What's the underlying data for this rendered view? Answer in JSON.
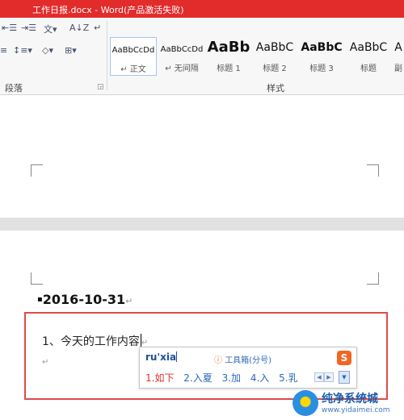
{
  "window": {
    "title": "工作日报.docx - Word(产品激活失败)"
  },
  "ribbon": {
    "paragraph_group": {
      "label": "段落",
      "tools": [
        {
          "icon": "decrease-indent-icon",
          "glyph": "⇤☰"
        },
        {
          "icon": "increase-indent-icon",
          "glyph": "⇥☰"
        },
        {
          "icon": "chinese-layout-icon",
          "glyph": "文▾"
        },
        {
          "icon": "sort-icon",
          "glyph": "A↓Z"
        },
        {
          "icon": "show-marks-icon",
          "glyph": "↵"
        },
        {
          "icon": "align-icon",
          "glyph": "≡"
        },
        {
          "icon": "line-spacing-icon",
          "glyph": "↕≡▾"
        },
        {
          "icon": "shading-icon",
          "glyph": "◇▾"
        },
        {
          "icon": "borders-icon",
          "glyph": "⊞▾"
        }
      ]
    },
    "styles_group": {
      "label": "样式",
      "items": [
        {
          "sample": "AaBbCcDd",
          "name": "↵ 正文",
          "selected": true
        },
        {
          "sample": "AaBbCcDd",
          "name": "↵ 无间隔",
          "selected": false
        },
        {
          "sample": "AaBb",
          "name": "标题 1",
          "selected": false
        },
        {
          "sample": "AaBbC",
          "name": "标题 2",
          "selected": false
        },
        {
          "sample": "AaBbC",
          "name": "标题 3",
          "selected": false
        },
        {
          "sample": "AaBbC",
          "name": "标题",
          "selected": false
        },
        {
          "sample": "A",
          "name": "副",
          "selected": false
        }
      ]
    }
  },
  "document": {
    "heading": "2016-10-31",
    "heading_mark": "↵",
    "line1": "1、今天的工作内容",
    "line1_mark": "↵",
    "line2_mark": "↵"
  },
  "ime": {
    "composition": "ru'xia",
    "hint_icon": "ⓘ",
    "hint": "工具箱(分号)",
    "logo_letter": "S",
    "candidates": [
      "1.如下",
      "2.入夏",
      "3.加",
      "4.入",
      "5.乳"
    ],
    "prev_glyph": "◀",
    "next_glyph": "▶",
    "more_glyph": "▼"
  },
  "watermark": {
    "name": "纯净系统城",
    "url": "www.yidaimei.com"
  }
}
